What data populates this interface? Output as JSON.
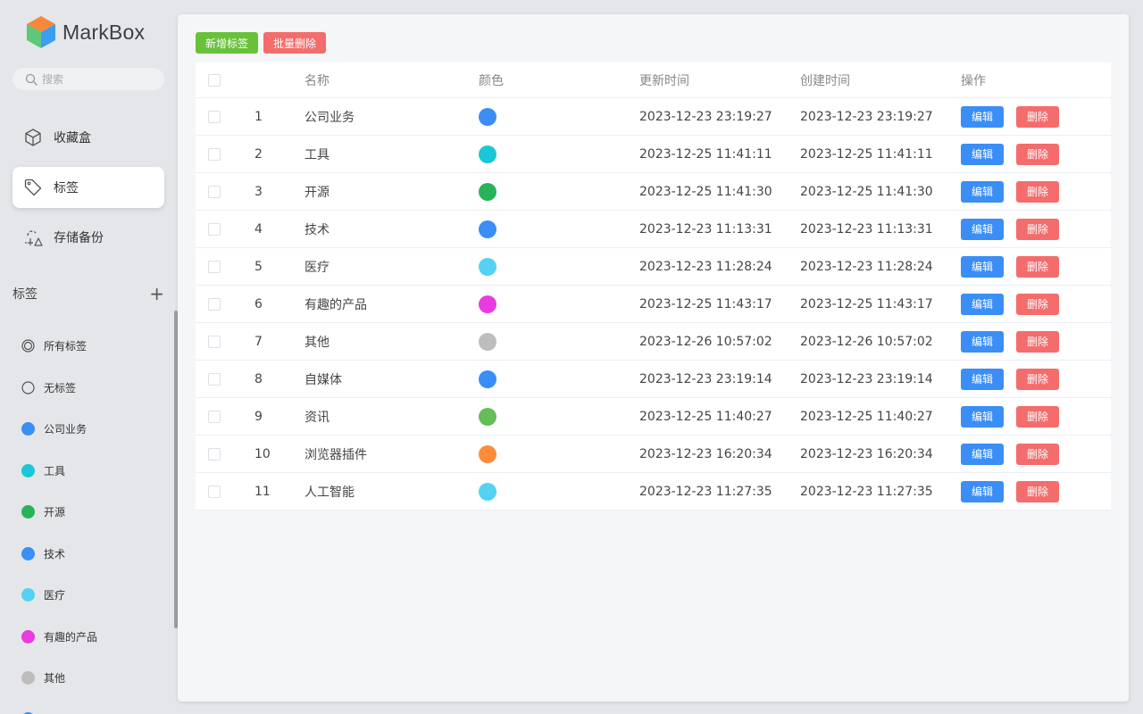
{
  "app": {
    "name": "MarkBox"
  },
  "search": {
    "placeholder": "搜索"
  },
  "nav": [
    {
      "label": "收藏盒",
      "icon": "box-icon",
      "active": false
    },
    {
      "label": "标签",
      "icon": "tag-icon",
      "active": true
    },
    {
      "label": "存储备份",
      "icon": "cloud-backup-icon",
      "active": false
    }
  ],
  "tag_section": {
    "title": "标签",
    "add_symbol": "+"
  },
  "sidebar_tags": [
    {
      "label": "所有标签",
      "kind": "all"
    },
    {
      "label": "无标签",
      "kind": "none"
    },
    {
      "label": "公司业务",
      "color": "#3a8ef6"
    },
    {
      "label": "工具",
      "color": "#1ac7d6"
    },
    {
      "label": "开源",
      "color": "#27b35a"
    },
    {
      "label": "技术",
      "color": "#3a8ef6"
    },
    {
      "label": "医疗",
      "color": "#55d1f2"
    },
    {
      "label": "有趣的产品",
      "color": "#e93be0"
    },
    {
      "label": "其他",
      "color": "#bdbdbd"
    }
  ],
  "toolbar": {
    "add_label": "新增标签",
    "batch_delete_label": "批量删除"
  },
  "table": {
    "headers": {
      "name": "名称",
      "color": "颜色",
      "updated": "更新时间",
      "created": "创建时间",
      "ops": "操作"
    },
    "edit_label": "编辑",
    "delete_label": "删除",
    "rows": [
      {
        "idx": "1",
        "name": "公司业务",
        "color": "#3a8ef6",
        "updated": "2023-12-23 23:19:27",
        "created": "2023-12-23 23:19:27"
      },
      {
        "idx": "2",
        "name": "工具",
        "color": "#1ac7d6",
        "updated": "2023-12-25 11:41:11",
        "created": "2023-12-25 11:41:11"
      },
      {
        "idx": "3",
        "name": "开源",
        "color": "#27b35a",
        "updated": "2023-12-25 11:41:30",
        "created": "2023-12-25 11:41:30"
      },
      {
        "idx": "4",
        "name": "技术",
        "color": "#3a8ef6",
        "updated": "2023-12-23 11:13:31",
        "created": "2023-12-23 11:13:31"
      },
      {
        "idx": "5",
        "name": "医疗",
        "color": "#55d1f2",
        "updated": "2023-12-23 11:28:24",
        "created": "2023-12-23 11:28:24"
      },
      {
        "idx": "6",
        "name": "有趣的产品",
        "color": "#e93be0",
        "updated": "2023-12-25 11:43:17",
        "created": "2023-12-25 11:43:17"
      },
      {
        "idx": "7",
        "name": "其他",
        "color": "#bdbdbd",
        "updated": "2023-12-26 10:57:02",
        "created": "2023-12-26 10:57:02"
      },
      {
        "idx": "8",
        "name": "自媒体",
        "color": "#3a8ef6",
        "updated": "2023-12-23 23:19:14",
        "created": "2023-12-23 23:19:14"
      },
      {
        "idx": "9",
        "name": "资讯",
        "color": "#67bd5a",
        "updated": "2023-12-25 11:40:27",
        "created": "2023-12-25 11:40:27"
      },
      {
        "idx": "10",
        "name": "浏览器插件",
        "color": "#fa8c3c",
        "updated": "2023-12-23 16:20:34",
        "created": "2023-12-23 16:20:34"
      },
      {
        "idx": "11",
        "name": "人工智能",
        "color": "#55d1f2",
        "updated": "2023-12-23 11:27:35",
        "created": "2023-12-23 11:27:35"
      }
    ]
  }
}
